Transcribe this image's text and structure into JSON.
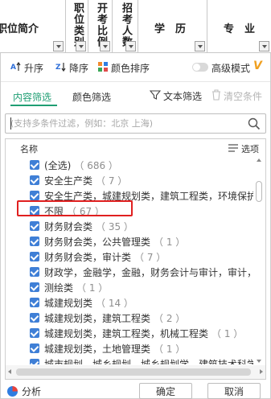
{
  "sheet_columns": [
    {
      "id": "col-position-intro",
      "label": "职位简介"
    },
    {
      "id": "col-position-type",
      "label": "职位类别"
    },
    {
      "id": "col-exam-ratio",
      "label": "开考比例"
    },
    {
      "id": "col-recruit-count",
      "label": "招考人数"
    },
    {
      "id": "col-education",
      "label": "学　历"
    },
    {
      "id": "col-major",
      "label": "专　业"
    }
  ],
  "toolbar": {
    "sort_asc": "升序",
    "sort_desc": "降序",
    "color_sort": "颜色排序",
    "advanced_mode": "高级模式",
    "vip_badge": "V"
  },
  "filter_tabs": {
    "content_filter": "内容筛选",
    "color_filter": "颜色筛选",
    "text_filter": "文本筛选",
    "clear_conditions": "清空条件"
  },
  "search": {
    "placeholder": "(支持多条件过滤，例如：北京 上海)",
    "value": ""
  },
  "list": {
    "header_name": "名称",
    "header_options": "选项",
    "items": [
      {
        "label": "(全选)",
        "count": "（ 686 ）",
        "checked": true
      },
      {
        "label": "安全生产类",
        "count": "（ 7 ）",
        "checked": true
      },
      {
        "label": "安全生产类，城建规划类，建筑工程类，环境保护",
        "count": "",
        "checked": true
      },
      {
        "label": "不限",
        "count": "（ 67 ）",
        "checked": true
      },
      {
        "label": "财务财会类",
        "count": "（ 35 ）",
        "checked": true
      },
      {
        "label": "财务财会类，公共管理类",
        "count": "（ 1 ）",
        "checked": true
      },
      {
        "label": "财务财会类，审计类",
        "count": "（ 7 ）",
        "checked": true
      },
      {
        "label": "财政学，金融学，金融，财务会计与审计，审计，",
        "count": "",
        "checked": true
      },
      {
        "label": "测绘类",
        "count": "（ 1 ）",
        "checked": true
      },
      {
        "label": "城建规划类",
        "count": "（ 14 ）",
        "checked": true
      },
      {
        "label": "城建规划类，建筑工程类",
        "count": "（ 2 ）",
        "checked": true
      },
      {
        "label": "城建规划类，建筑工程类，机械工程类",
        "count": "（ 1 ）",
        "checked": true
      },
      {
        "label": "城建规划类，土地管理类",
        "count": "（ 1 ）",
        "checked": true
      },
      {
        "label": "城市规划，城乡规划，城乡规划学，建筑技术科学",
        "count": "",
        "checked": true
      }
    ]
  },
  "footer": {
    "analysis": "分析",
    "ok": "确定",
    "cancel": "取消"
  },
  "colors": {
    "accent_green": "#1f9e73",
    "checkbox_blue": "#3f7fd6",
    "highlight_red": "#e02020",
    "vip_orange": "#f0a020"
  }
}
